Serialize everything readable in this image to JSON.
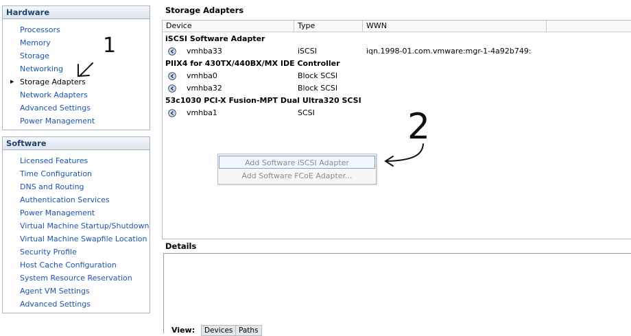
{
  "hardware": {
    "title": "Hardware",
    "items": [
      {
        "label": "Processors"
      },
      {
        "label": "Memory"
      },
      {
        "label": "Storage"
      },
      {
        "label": "Networking"
      },
      {
        "label": "Storage Adapters",
        "selected": true
      },
      {
        "label": "Network Adapters"
      },
      {
        "label": "Advanced Settings"
      },
      {
        "label": "Power Management"
      }
    ]
  },
  "software": {
    "title": "Software",
    "items": [
      {
        "label": "Licensed Features"
      },
      {
        "label": "Time Configuration"
      },
      {
        "label": "DNS and Routing"
      },
      {
        "label": "Authentication Services"
      },
      {
        "label": "Power Management"
      },
      {
        "label": "Virtual Machine Startup/Shutdown"
      },
      {
        "label": "Virtual Machine Swapfile Location"
      },
      {
        "label": "Security Profile"
      },
      {
        "label": "Host Cache Configuration"
      },
      {
        "label": "System Resource Reservation"
      },
      {
        "label": "Agent VM Settings"
      },
      {
        "label": "Advanced Settings"
      }
    ]
  },
  "storage_adapters": {
    "title": "Storage Adapters",
    "columns": [
      "Device",
      "Type",
      "WWN"
    ],
    "groups": [
      {
        "name": "iSCSI Software Adapter",
        "devices": [
          {
            "device": "vmhba33",
            "type": "iSCSI",
            "wwn": "iqn.1998-01.com.vmware:mgr-1-4a92b749:"
          }
        ]
      },
      {
        "name": "PIIX4 for 430TX/440BX/MX IDE Controller",
        "devices": [
          {
            "device": "vmhba0",
            "type": "Block SCSI",
            "wwn": ""
          },
          {
            "device": "vmhba32",
            "type": "Block SCSI",
            "wwn": ""
          }
        ]
      },
      {
        "name": "53c1030 PCI-X Fusion-MPT Dual Ultra320 SCSI",
        "devices": [
          {
            "device": "vmhba1",
            "type": "SCSI",
            "wwn": ""
          }
        ]
      }
    ]
  },
  "context_menu": {
    "items": [
      "Add Software iSCSI Adapter",
      "Add Software FCoE Adapter..."
    ]
  },
  "details": {
    "title": "Details",
    "view_label": "View:",
    "buttons": [
      "Devices",
      "Paths"
    ]
  },
  "annotations": {
    "step1": "1",
    "step2": "2"
  },
  "colors": {
    "link": "#1a54b0",
    "header_text": "#1f3f6e",
    "menu_hover_border": "#7da2ce"
  },
  "icons": {
    "adapter": "storage-adapter-icon"
  }
}
